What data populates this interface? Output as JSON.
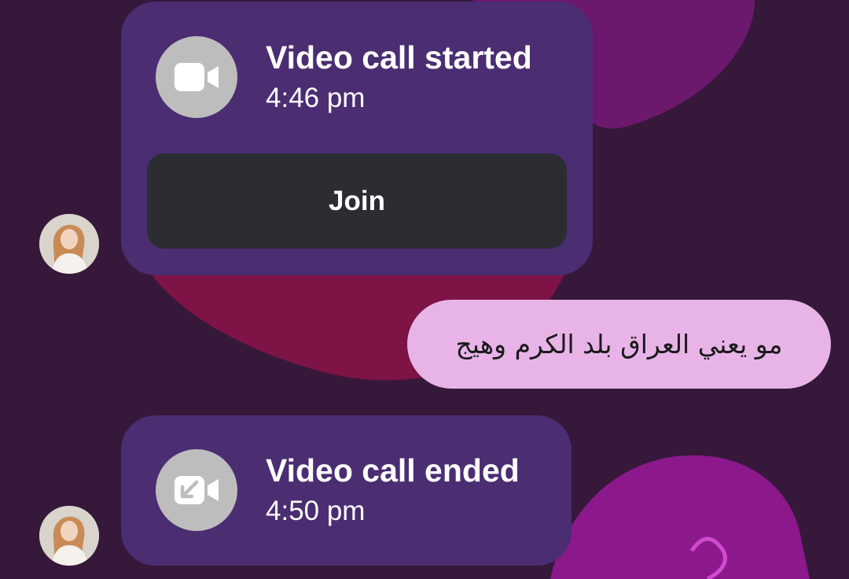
{
  "messages": {
    "call_started": {
      "title": "Video call started",
      "time": "4:46 pm",
      "join_label": "Join",
      "icon": "video-camera-icon"
    },
    "outgoing_text": "مو يعني العراق بلد الكرم وهيج",
    "call_ended": {
      "title": "Video call ended",
      "time": "4:50 pm",
      "icon": "video-call-ended-icon"
    }
  },
  "colors": {
    "background": "#36183a",
    "call_bubble": "#4b2d72",
    "join_button": "#2b2d32",
    "outgoing_bubble": "#e8b4e8",
    "icon_circle": "#bdbdbd"
  }
}
